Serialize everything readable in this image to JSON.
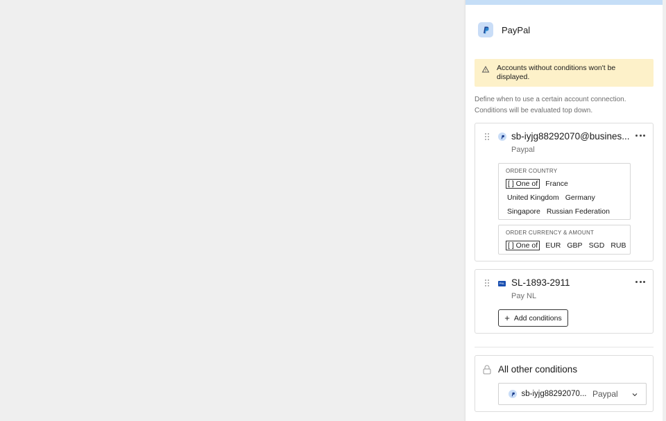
{
  "header": {
    "title": "PayPal",
    "icon": "paypal-icon"
  },
  "warning": {
    "text": "Accounts without conditions won't be displayed.",
    "icon": "warning-icon"
  },
  "description": "Define when to use a certain account connection. Conditions will be evaluated top down.",
  "accounts": [
    {
      "name": "sb-iyjg88292070@busines...",
      "provider": "Paypal",
      "icon": "paypal-icon",
      "conditions": [
        {
          "label": "ORDER COUNTRY",
          "operator": "[ ] One of",
          "values": [
            "France",
            "United Kingdom",
            "Germany",
            "Singapore",
            "Russian Federation"
          ]
        },
        {
          "label": "ORDER CURRENCY & AMOUNT",
          "operator": "[ ] One of",
          "values": [
            "EUR",
            "GBP",
            "SGD",
            "RUB"
          ]
        }
      ]
    },
    {
      "name": "SL-1893-2911",
      "provider": "Pay NL",
      "icon": "paynl-icon",
      "add_conditions_label": "Add conditions"
    }
  ],
  "fallback": {
    "title": "All other conditions",
    "selected_account": "sb-iyjg88292070...",
    "selected_provider": "Paypal"
  },
  "colors": {
    "topbar": "#c5def7",
    "warning_bg": "#fdf1c9",
    "paypal_icon_bg": "#c9ddf7",
    "paynl_blue": "#1a4fb0"
  }
}
